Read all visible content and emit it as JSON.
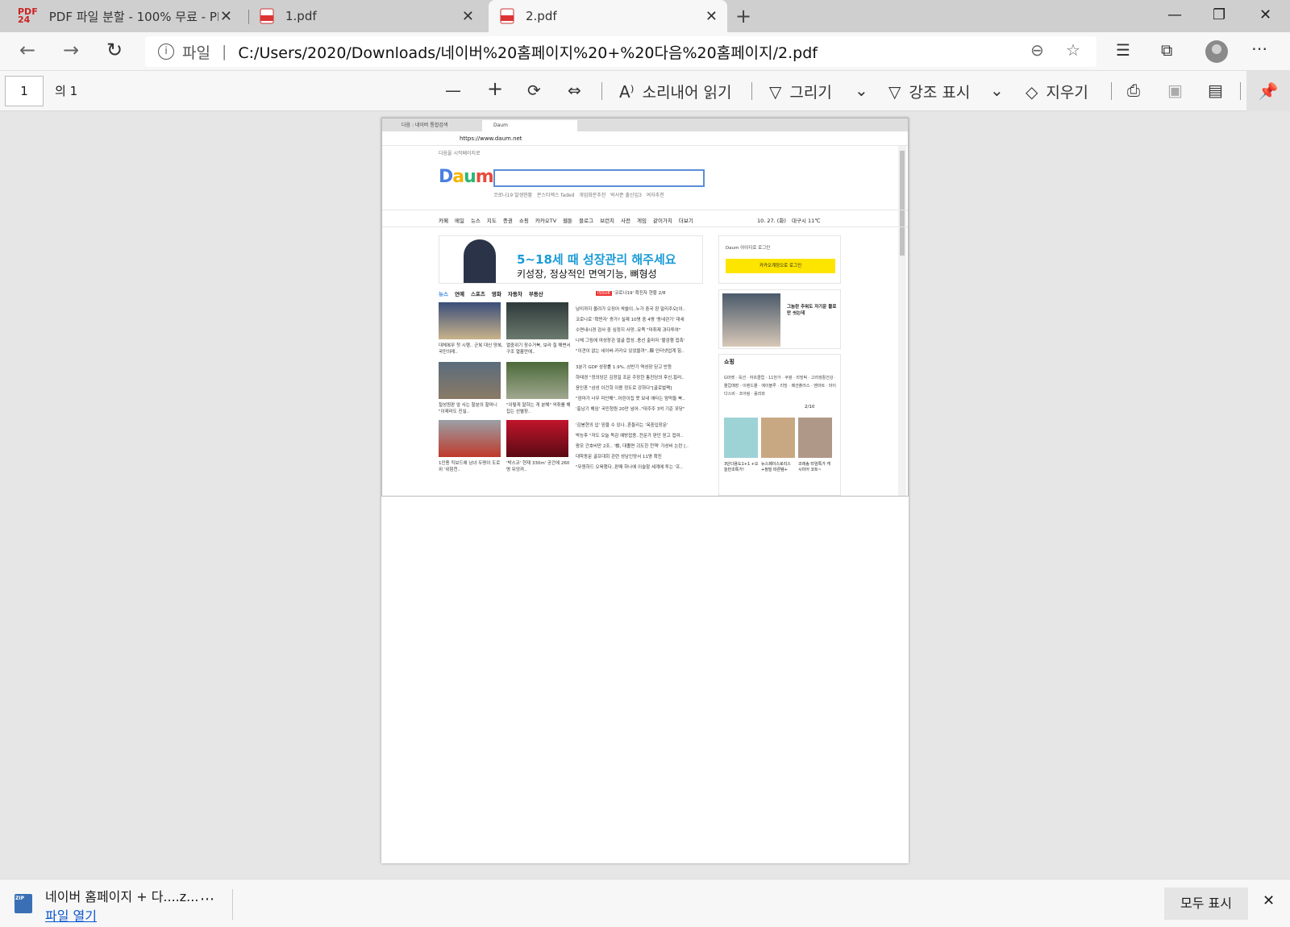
{
  "browser": {
    "tabs": [
      {
        "label": "PDF 파일 분할 - 100% 무료 - PDF24 Tools"
      },
      {
        "label": "1.pdf"
      },
      {
        "label": "2.pdf"
      }
    ],
    "address": {
      "prefix": "파일",
      "url": "C:/Users/2020/Downloads/네이버%20홈페이지%20+%20다음%20홈페이지/2.pdf"
    }
  },
  "pdf_toolbar": {
    "page_number": "1",
    "page_of": "의 1",
    "read_aloud": "소리내어 읽기",
    "draw": "그리기",
    "highlight": "강조 표시",
    "erase": "지우기"
  },
  "pdf_content": {
    "mini_tabs": [
      "다음 : 네이버 통합검색",
      "Daum"
    ],
    "mini_url": "https://www.daum.net",
    "start_page": "다음을 시작페이지로",
    "logo": "Daum",
    "trending": "코로나19 발생현황   몬스타엑스 faded   개업화분추천   박서준 출산임3   여자추천",
    "nav": [
      "카페",
      "메일",
      "뉴스",
      "지도",
      "증권",
      "쇼핑",
      "카카오TV",
      "웹툰",
      "블로그",
      "브런치",
      "사전",
      "게임",
      "같이가치",
      "더보기"
    ],
    "date": "10. 27. (화)",
    "weather": "대구시  11℃",
    "banner_title": "5~18세 때 성장관리 해주세요",
    "banner_sub": "키성장, 정상적인 면역기능, 뼈형성",
    "login_id": "Daum 아이디로 로그인",
    "login_kakao": "카카오계정으로 로그인",
    "news_tabs": [
      "뉴스",
      "연예",
      "스포츠",
      "영화",
      "자동차",
      "부동산"
    ],
    "issue": "'코로나19' 확진자 현황",
    "issue_page": "2/8",
    "captions": [
      "대체복무 첫 시행.. 군복 대신 양복, 국민의례..",
      "열중위기 장수거북, 보라 칠 해변서 구조 열흘만에..",
      "철성원판 앞 사는 할분의 할머니 \"이제라도 진실..",
      "\"이렇게 말하는 게 분해\" 악취를 해집는 선별장..",
      "1인용 킥보드에 남녀 두명이 도로 위 '위험천..",
      "'박스코' 현재 330m' 공간에 260명 뒤엉켜.."
    ],
    "headlines": [
      "남미까지 몰려가 오징어 싹쓸이..누가 중국 왼 말리주오[이..",
      "코로나로 '확찐자' 증가? 실제 10명 중 4명 '동네걷기' 대세",
      "수면내시경 검사 중 심정지 사망..유족 \"마취제 과다투여\"",
      "나체 그림에 여성장관 얼굴 합성..충선 출마자 '불검행 접촉'",
      "\"이견이 없는 네이버-카카오 있었을까\"..韓 인터넷업계 힘..",
      "3분기 GDP 성장률 1.9%..상반기 역성장 딛고 반등",
      "하태경 \"정의당은 김정일 조문 주장한 통진당의 후신,횡러..",
      "윤인혼 \"삼성 이건희 이용 정도로 강하다\"[골로벌팩]",
      "\"엄마가 너무 미안해\"..어린이집 못 보내 애타는 맘먹들 북..",
      "'홍남기 해임' 국민청원 20만 넘어..\"대주주 3억 기준 포당\"",
      "'김봉현의 입' 믿을 수 있나..흔들리는 '옥중입장문'",
      "박능후 \"저도 오늘 독감 예방접종..전문가 판단 믿고 접여..",
      "왕모 간호비만 2조.. '檢, 대졸면 괴도한 천책' 가성비 논란 [..",
      "대학동문 골프대회 관련 성남인양서 11명 확진",
      "\"무원하드 오육했다..판매 하나에 이슬항 세계에 투는 '프.."
    ],
    "side_ad": "그놈란 추워도 자기운 물로만 씻는데",
    "shopping": "쇼핑",
    "shopping_links": "G마켓 · 옥션 · 하프클럽 · 11번가 · 쿠팡 · 리빙픽 · 고려생활건강 · 몰캅매장 · 이랜드몰 · 에이블루 · 리빙 · 패션플러스 · 멘마트 · 마이다스비 · 조아링 · 롤리와",
    "shop_page": "2/10",
    "shop_caps": [
      "3단다용도1+1 +오늘만조특가!",
      "뉴스페이스로리스 +정밀 따른템+",
      "코레송 타임특가 캐시미어 코트~"
    ]
  },
  "download": {
    "filename": "네이버 홈페이지 + 다....z...",
    "open_link": "파일 열기",
    "show_all": "모두 표시"
  }
}
